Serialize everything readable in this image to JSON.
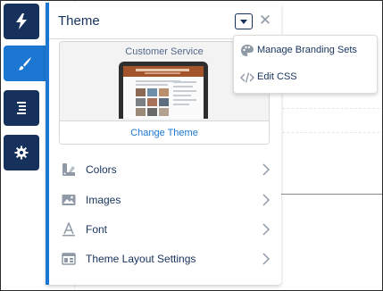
{
  "panel": {
    "title": "Theme",
    "card": {
      "title": "Customer Service",
      "change_label": "Change Theme"
    },
    "items": [
      {
        "label": "Colors",
        "icon": "paint-palette-icon"
      },
      {
        "label": "Images",
        "icon": "image-icon"
      },
      {
        "label": "Font",
        "icon": "font-icon"
      },
      {
        "label": "Theme Layout Settings",
        "icon": "layout-icon"
      }
    ]
  },
  "dropdown": {
    "items": [
      {
        "label": "Manage Branding Sets",
        "icon": "palette-icon"
      },
      {
        "label": "Edit CSS",
        "icon": "code-icon"
      }
    ]
  },
  "rail": {
    "items": [
      {
        "icon": "lightning-icon",
        "active": false
      },
      {
        "icon": "brush-icon",
        "active": true
      },
      {
        "icon": "page-structure-icon",
        "active": false
      },
      {
        "icon": "gear-icon",
        "active": false
      }
    ]
  },
  "colors": {
    "navy": "#16325c",
    "brand_blue": "#1b77d2",
    "icon_gray": "#8f9aa6"
  }
}
